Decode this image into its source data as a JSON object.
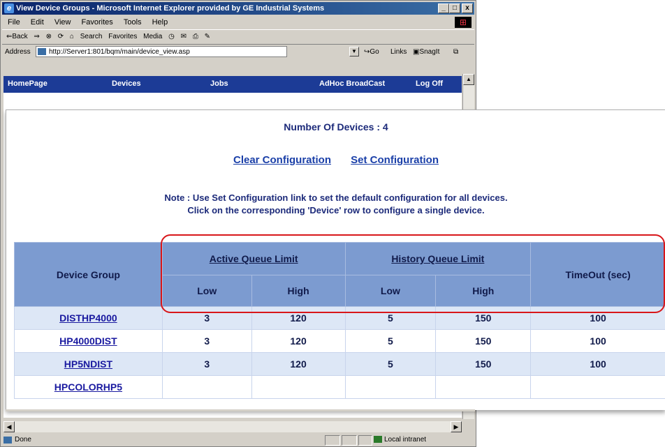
{
  "window": {
    "title": "View Device Groups - Microsoft Internet Explorer provided by GE Industrial Systems",
    "controls": [
      "_",
      "□",
      "x"
    ]
  },
  "menu": [
    "File",
    "Edit",
    "View",
    "Favorites",
    "Tools",
    "Help"
  ],
  "toolbar": {
    "back": "⇐Back",
    "search": "Search",
    "favorites": "Favorites",
    "media": "Media"
  },
  "address": {
    "label": "Address",
    "url": "http://Server1:801/bqm/main/device_view.asp",
    "go": "Go",
    "links": "Links",
    "snagit": "SnagIt"
  },
  "nav": [
    "HomePage",
    "Devices",
    "Jobs",
    "AdHoc BroadCast",
    "Log Off"
  ],
  "page": {
    "num_devices": "Number Of Devices : 4",
    "clear_config": "Clear Configuration",
    "set_config": "Set Configuration",
    "note_line1": "Note : Use Set Configuration link to set the default configuration for all devices.",
    "note_line2": "Click on the corresponding 'Device' row to configure a single device."
  },
  "table": {
    "headers": {
      "device_group": "Device Group",
      "active_queue": "Active Queue Limit",
      "history_queue": "History Queue Limit",
      "timeout": "TimeOut (sec)",
      "low": "Low",
      "high": "High"
    },
    "rows": [
      {
        "group": "DISTHP4000",
        "active_low": "3",
        "active_high": "120",
        "history_low": "5",
        "history_high": "150",
        "timeout": "100"
      },
      {
        "group": "HP4000DIST",
        "active_low": "3",
        "active_high": "120",
        "history_low": "5",
        "history_high": "150",
        "timeout": "100"
      },
      {
        "group": "HP5NDIST",
        "active_low": "3",
        "active_high": "120",
        "history_low": "5",
        "history_high": "150",
        "timeout": "100"
      },
      {
        "group": "HPCOLORHP5",
        "active_low": "",
        "active_high": "",
        "history_low": "",
        "history_high": "",
        "timeout": ""
      }
    ]
  },
  "status": {
    "text": "Done",
    "zone": "Local intranet"
  },
  "colors": {
    "nav_bg": "#1c3b96",
    "header_bg": "#7c9bd0",
    "alt_row": "#dde7f6",
    "highlight": "#d8161a"
  }
}
